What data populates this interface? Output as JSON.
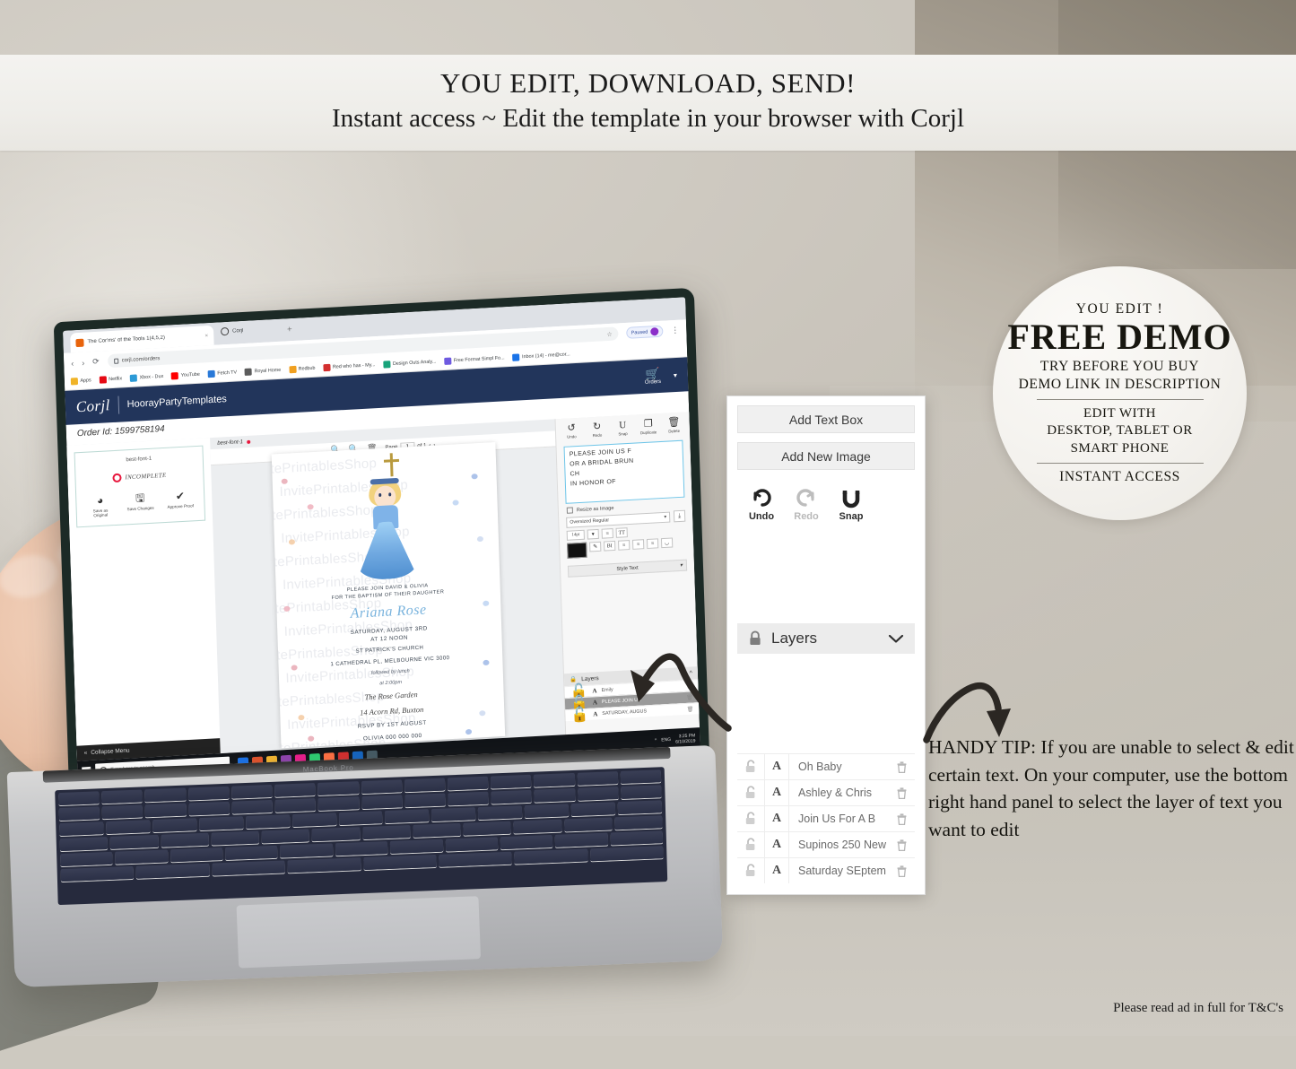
{
  "banner": {
    "line1": "YOU EDIT, DOWNLOAD, SEND!",
    "line2": "Instant access ~ Edit the template in your browser with Corjl"
  },
  "demo_badge": {
    "eyebrow": "YOU EDIT !",
    "headline": "FREE DEMO",
    "try_line1": "TRY BEFORE YOU BUY",
    "try_line2": "DEMO LINK IN DESCRIPTION",
    "edit_line1": "EDIT WITH",
    "edit_line2": "DESKTOP, TABLET OR",
    "edit_line3": "SMART PHONE",
    "instant": "INSTANT ACCESS"
  },
  "overlay_panel": {
    "add_text_box": "Add Text Box",
    "add_new_image": "Add New Image",
    "tools": [
      {
        "label": "Undo",
        "icon": "undo-icon",
        "disabled": false
      },
      {
        "label": "Redo",
        "icon": "redo-icon",
        "disabled": true
      },
      {
        "label": "Snap",
        "icon": "magnet-icon",
        "disabled": false
      }
    ],
    "layers_title": "Layers",
    "layers": [
      {
        "name": "Oh Baby"
      },
      {
        "name": "Ashley & Chris"
      },
      {
        "name": "Join Us For A B"
      },
      {
        "name": "Supinos 250 New"
      },
      {
        "name": "Saturday SEptem"
      }
    ]
  },
  "handy_tip": "HANDY TIP: If you are unable to select & edit certain text. On your computer, use the bottom right hand panel to select the layer of text you want to edit",
  "footer_note": "Please read ad in full for T&C's",
  "laptop": {
    "model": "MacBook Pro",
    "browser": {
      "tab_title": "The Cor'ms' of the Tools 1(4,5,2)",
      "tab2_title": "Corjl",
      "url": "corjl.com/orders",
      "extension_label": "Paused",
      "bookmarks": [
        {
          "label": "Apps",
          "color": "#f0b429"
        },
        {
          "label": "Netflix",
          "color": "#e50914"
        },
        {
          "label": "Xbox - Dux",
          "color": "#2c9ad6"
        },
        {
          "label": "YouTube",
          "color": "#ff0000"
        },
        {
          "label": "Fetch TV",
          "color": "#2979d8"
        },
        {
          "label": "Royal Home",
          "color": "#5c5c5c"
        },
        {
          "label": "Redbub",
          "color": "#f0a020"
        },
        {
          "label": "Red who has - My...",
          "color": "#d32f2f"
        },
        {
          "label": "Design Outs Analy...",
          "color": "#17a37a"
        },
        {
          "label": "Free Format Simpl Fo...",
          "color": "#6e5ae0"
        },
        {
          "label": "Inbox (14) - me@cor...",
          "color": "#1a73e8"
        }
      ]
    },
    "app": {
      "logo": "Corjl",
      "shop_name": "HoorayPartyTemplates",
      "cart_label": "Orders",
      "order_id": "Order Id: 1599758194",
      "collapse_menu": "Collapse Menu",
      "thumbnail": {
        "title": "best-font-1",
        "status": "INCOMPLETE",
        "actions": [
          {
            "label": "Save as Original",
            "icon": "revert-icon"
          },
          {
            "label": "Save Changes",
            "icon": "save-icon"
          },
          {
            "label": "Approve Proof",
            "icon": "check-icon"
          }
        ]
      },
      "canvas": {
        "doc_tab": "best-font-1",
        "page_label": "Page",
        "page_value": "1",
        "page_total": "of 1"
      },
      "text_editor": {
        "content_lines": [
          "PLEASE JOIN US F",
          "OR A BRIDAL BRUN",
          "CH",
          "IN HONOR OF"
        ],
        "resize_checkbox_label": "Resize as Image",
        "font_name": "Oversized Regular",
        "font_size": "14pt",
        "style_text_label": "Style Text"
      },
      "layers_title": "Layers",
      "layers": [
        {
          "name": "Emily",
          "selected": false
        },
        {
          "name": "PLEASE JOIN US",
          "selected": true
        },
        {
          "name": "SATURDAY, AUGUS",
          "selected": false
        }
      ]
    },
    "taskbar": {
      "search_placeholder": "Type here to search",
      "time": "3:25 PM",
      "date": "6/10/2019"
    },
    "invitation": {
      "watermark": "InvitePrintablesShop",
      "intro_line1": "PLEASE JOIN DAVID & OLIVIA",
      "intro_line2": "FOR THE BAPTISM OF THEIR DAUGHTER",
      "name": "Ariana Rose",
      "date_line1": "SATURDAY, AUGUST 3RD",
      "date_line2": "AT 12 NOON",
      "venue_line1": "ST PATRICK'S CHURCH",
      "venue_line2": "1 CATHEDRAL PL, MELBOURNE VIC 3000",
      "lunch_line1": "followed by lunch",
      "lunch_line2": "at 2:00pm",
      "reception_line1": "The Rose Garden",
      "reception_line2": "14 Acorn Rd, Buxton",
      "rsvp_line1": "RSVP BY 1ST AUGUST",
      "rsvp_line2": "OLIVIA 000 000 000"
    }
  }
}
